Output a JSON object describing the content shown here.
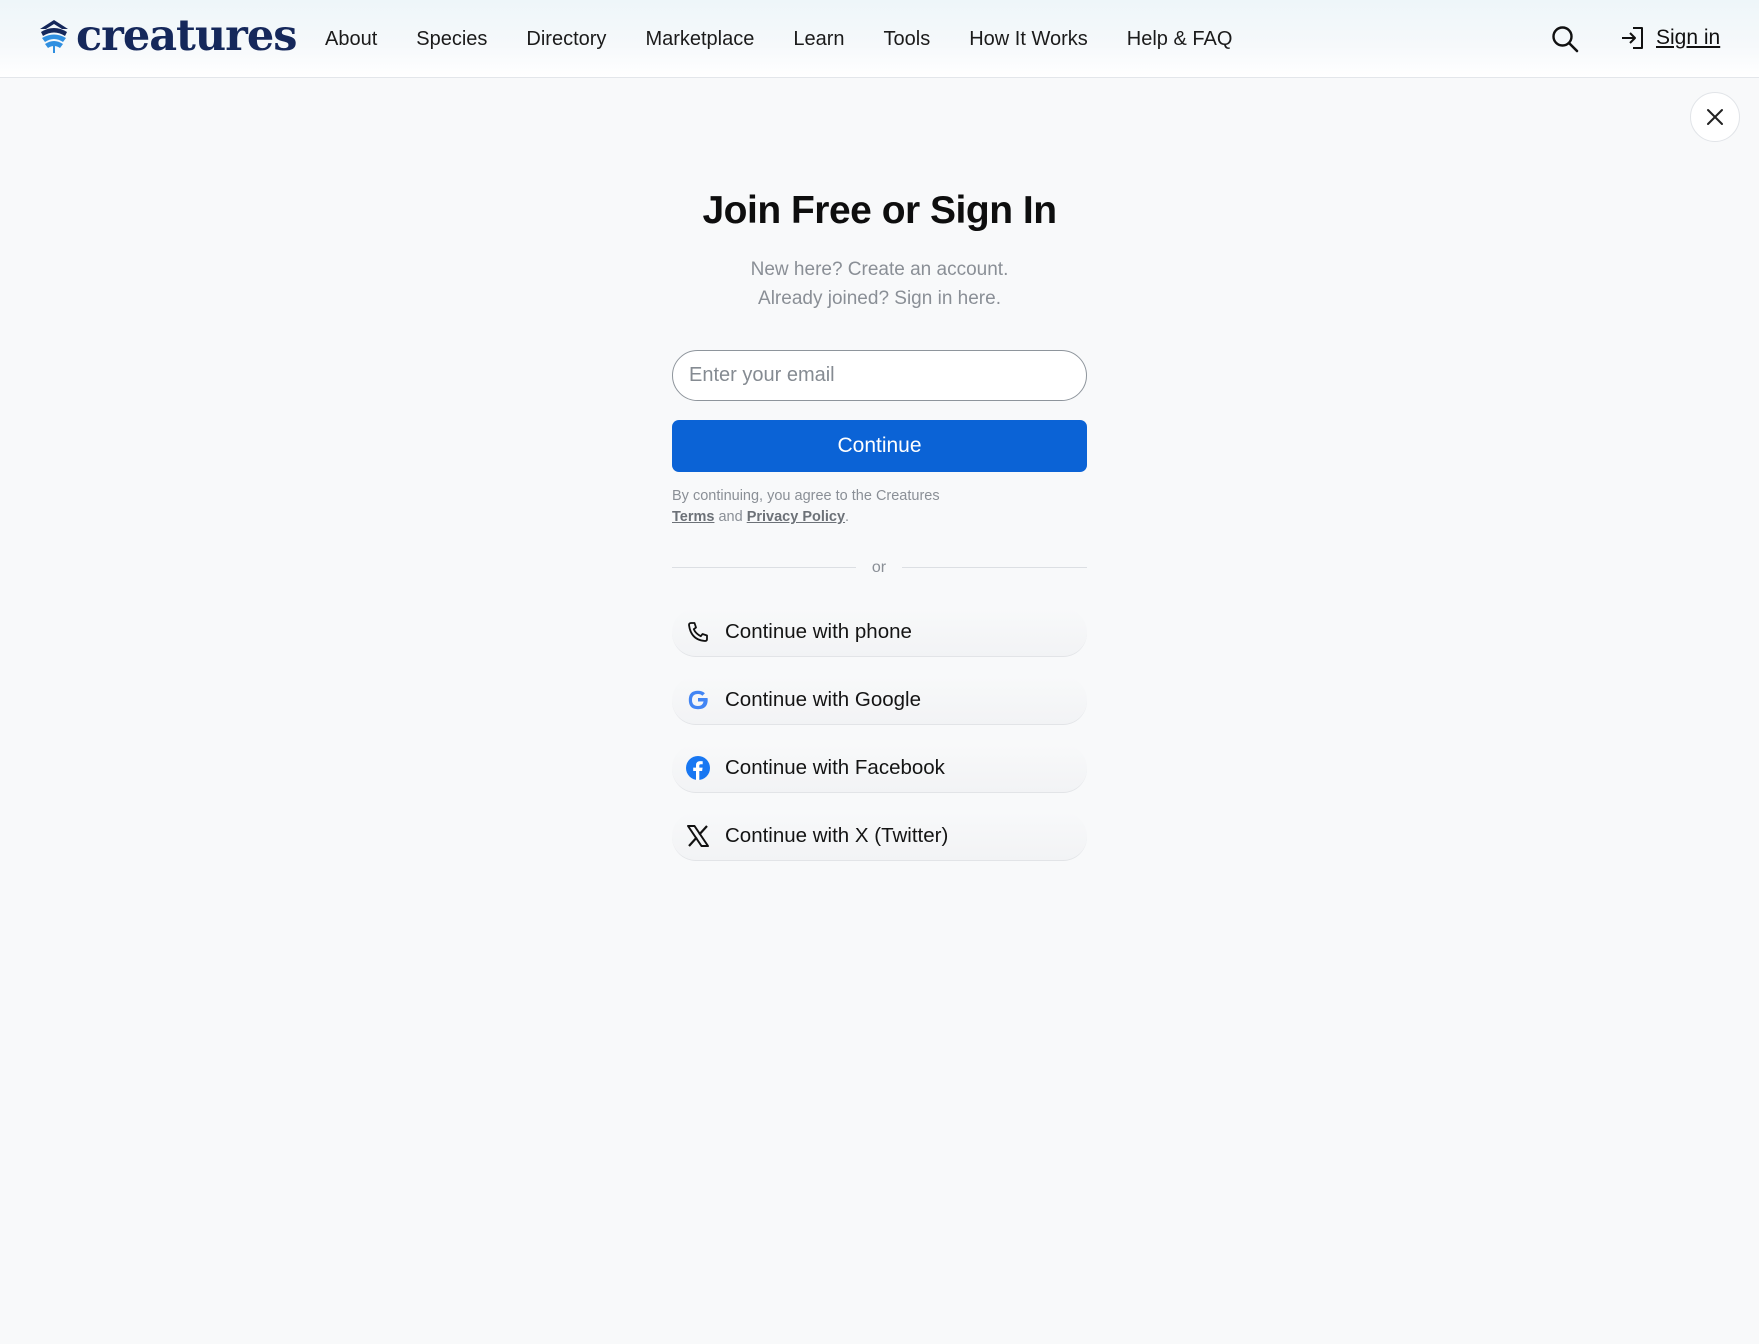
{
  "brand": {
    "name": "creatures",
    "color": "#15285b",
    "accent": "#2f8fe0"
  },
  "nav": {
    "items": [
      {
        "label": "About"
      },
      {
        "label": "Species"
      },
      {
        "label": "Directory"
      },
      {
        "label": "Marketplace"
      },
      {
        "label": "Learn"
      },
      {
        "label": "Tools"
      },
      {
        "label": "How It Works"
      },
      {
        "label": "Help & FAQ"
      }
    ],
    "search_icon": "search-icon",
    "signin_label": "Sign in",
    "signin_icon": "sign-in-icon"
  },
  "modal": {
    "close_icon": "close-icon",
    "title": "Join Free or Sign In",
    "subtitle_line1": "New here? Create an account.",
    "subtitle_line2": "Already joined? Sign in here.",
    "email_placeholder": "Enter your email",
    "email_value": "",
    "continue_label": "Continue",
    "continue_color": "#0b63d6",
    "legal": {
      "prefix": "By continuing, you agree to the Creatures ",
      "terms": "Terms",
      "and": " and ",
      "privacy": "Privacy Policy",
      "suffix": "."
    },
    "divider_text": "or",
    "social_buttons": [
      {
        "label": "Continue with phone",
        "icon": "phone-icon"
      },
      {
        "label": "Continue with Google",
        "icon": "google-icon"
      },
      {
        "label": "Continue with Facebook",
        "icon": "facebook-icon"
      },
      {
        "label": "Continue with X (Twitter)",
        "icon": "x-twitter-icon"
      }
    ]
  }
}
